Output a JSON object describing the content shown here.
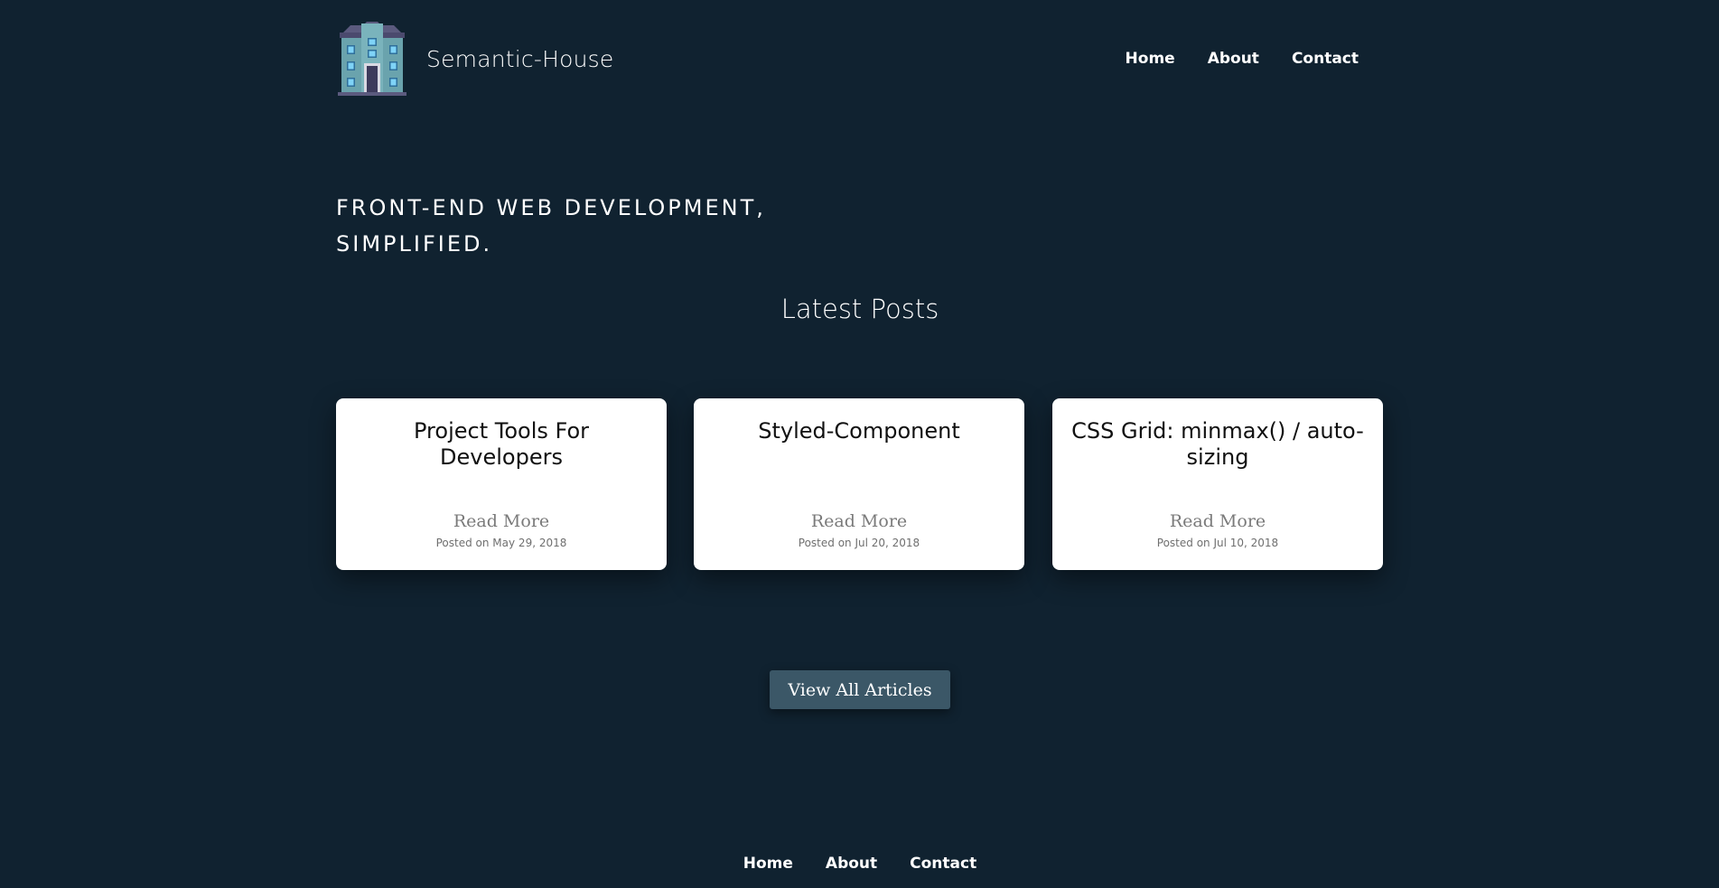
{
  "brand": {
    "name": "Semantic-House",
    "logo_icon": "house-icon"
  },
  "nav": {
    "home": "Home",
    "about": "About",
    "contact": "Contact"
  },
  "hero": {
    "line1": "Front-End Web Development,",
    "line2": "Simplified."
  },
  "latest": {
    "title": "Latest Posts",
    "posts": [
      {
        "title": "Project Tools For Developers",
        "link": "Read More",
        "date": "Posted on May 29, 2018"
      },
      {
        "title": "Styled-Component",
        "link": "Read More",
        "date": "Posted on Jul 20, 2018"
      },
      {
        "title": "CSS Grid: minmax() / auto-sizing",
        "link": "Read More",
        "date": "Posted on Jul 10, 2018"
      }
    ]
  },
  "view_all_label": "View All Articles",
  "footer": {
    "home": "Home",
    "about": "About",
    "contact": "Contact"
  },
  "colors": {
    "background": "#102230",
    "card": "#ffffff",
    "button": "#3b5767",
    "read_more": "#7a7a7a"
  }
}
